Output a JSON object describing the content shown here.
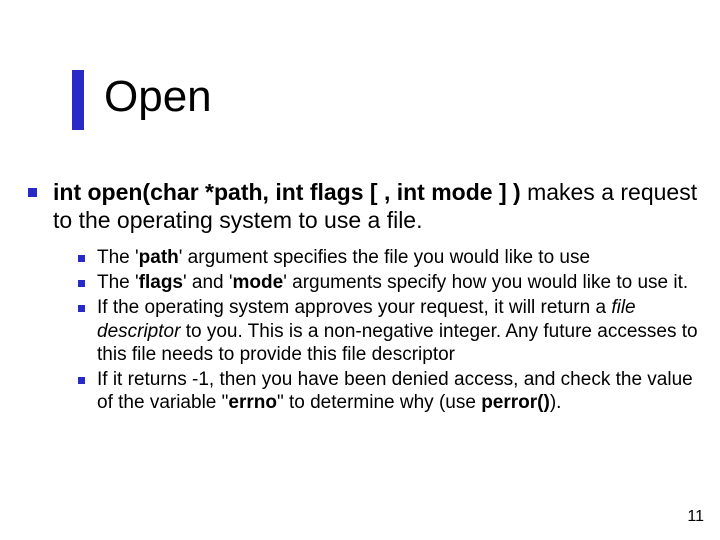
{
  "title": "Open",
  "main": {
    "signature_bold": "int open(char *path, int flags [ , int mode ] )",
    "signature_rest": "makes a request to the operating system to use a file."
  },
  "items": [
    {
      "pre": "The '",
      "kw": "path",
      "post": "' argument specifies the file you would like to use"
    },
    {
      "pre": "The '",
      "kw": "flags",
      "mid": "' and '",
      "kw2": "mode",
      "post": "' arguments specify how you would like to use it."
    },
    {
      "pre": "If the operating system approves your request, it will return a ",
      "ital": "file descriptor",
      "post": " to you. This is a non-negative integer. Any future accesses to this file needs to provide this file descriptor"
    },
    {
      "pre": "If it returns -1, then you have been denied access, and check the value of the variable \"",
      "kw": "errno",
      "mid": "\" to determine why (use ",
      "kw2": "perror()",
      "post": ")."
    }
  ],
  "page_number": "11"
}
